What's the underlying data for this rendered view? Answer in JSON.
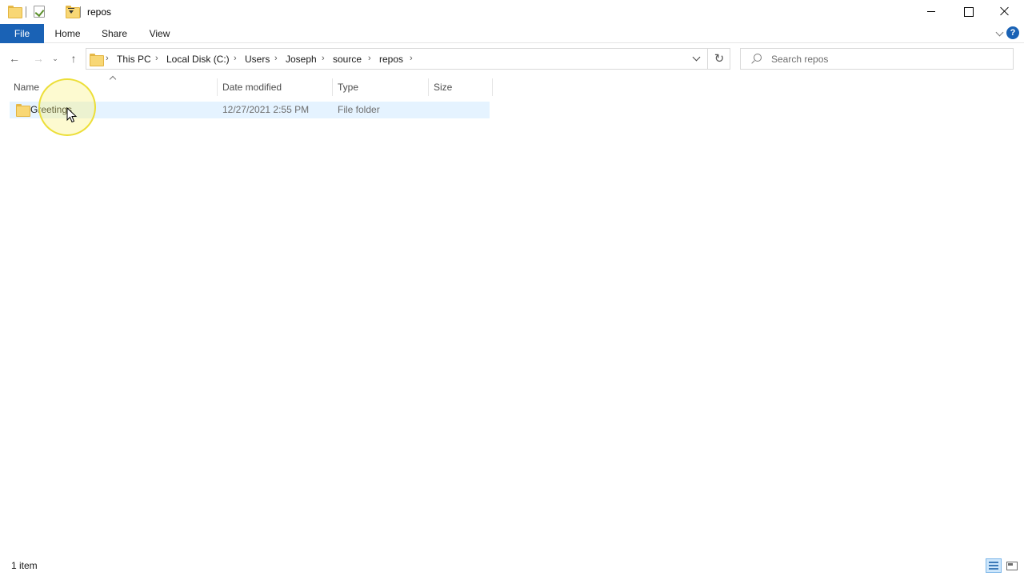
{
  "titlebar": {
    "title": "repos",
    "quick_access": [
      "folder-icon",
      "properties-icon",
      "new-folder-icon",
      "customize-dropdown-icon"
    ],
    "controls": [
      "minimize-icon",
      "maximize-icon",
      "close-icon"
    ]
  },
  "ribbon": {
    "tabs": [
      {
        "label": "File"
      },
      {
        "label": "Home"
      },
      {
        "label": "Share"
      },
      {
        "label": "View"
      }
    ],
    "help": "?"
  },
  "nav": {
    "back": "←",
    "forward": "→",
    "up": "↑",
    "refresh": "↻",
    "breadcrumbs": [
      "This PC",
      "Local Disk (C:)",
      "Users",
      "Joseph",
      "source",
      "repos"
    ]
  },
  "search": {
    "placeholder": "Search repos"
  },
  "columns": [
    "Name",
    "Date modified",
    "Type",
    "Size"
  ],
  "files": [
    {
      "name": "Greetings",
      "date_modified": "12/27/2021 2:55 PM",
      "type": "File folder",
      "size": "",
      "selected": true
    }
  ],
  "status": {
    "item_count": "1 item"
  },
  "colors": {
    "file_tab": "#1a62b5",
    "selection": "#e5f3ff",
    "cursor_highlight": "#f2e24a"
  }
}
